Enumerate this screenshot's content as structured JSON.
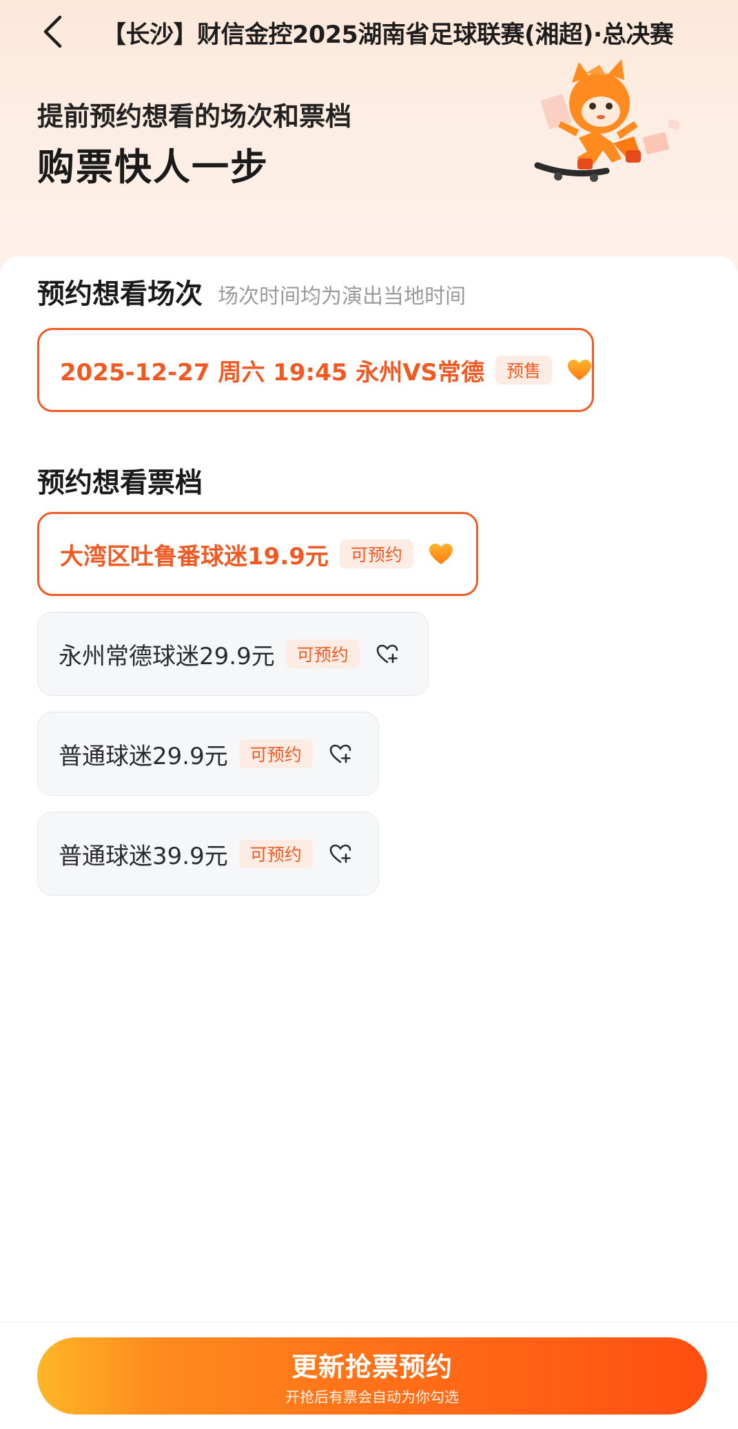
{
  "nav": {
    "title": "【长沙】财信金控2025湖南省足球联赛(湘超)·总决赛"
  },
  "hero": {
    "subtitle": "提前预约想看的场次和票档",
    "title": "购票快人一步"
  },
  "sessions": {
    "title": "预约想看场次",
    "note": "场次时间均为演出当地时间",
    "items": [
      {
        "label": "2025-12-27 周六 19:45 永州VS常德",
        "tag": "预售",
        "selected": true
      }
    ]
  },
  "tickets": {
    "title": "预约想看票档",
    "items": [
      {
        "label": "大湾区吐鲁番球迷19.9元",
        "tag": "可预约",
        "selected": true
      },
      {
        "label": "永州常德球迷29.9元",
        "tag": "可预约",
        "selected": false
      },
      {
        "label": "普通球迷29.9元",
        "tag": "可预约",
        "selected": false
      },
      {
        "label": "普通球迷39.9元",
        "tag": "可预约",
        "selected": false
      }
    ]
  },
  "footer": {
    "cta_label": "更新抢票预约",
    "cta_sub": "开抢后有票会自动为你勾选"
  },
  "colors": {
    "accent": "#f05a22",
    "tag_bg": "#fdece4",
    "heart_filled": "#ff9a1a"
  },
  "icons": {
    "back": "chevron-left-icon",
    "heart_selected": "heart-filled-icon",
    "heart_unselected": "heart-plus-icon"
  }
}
